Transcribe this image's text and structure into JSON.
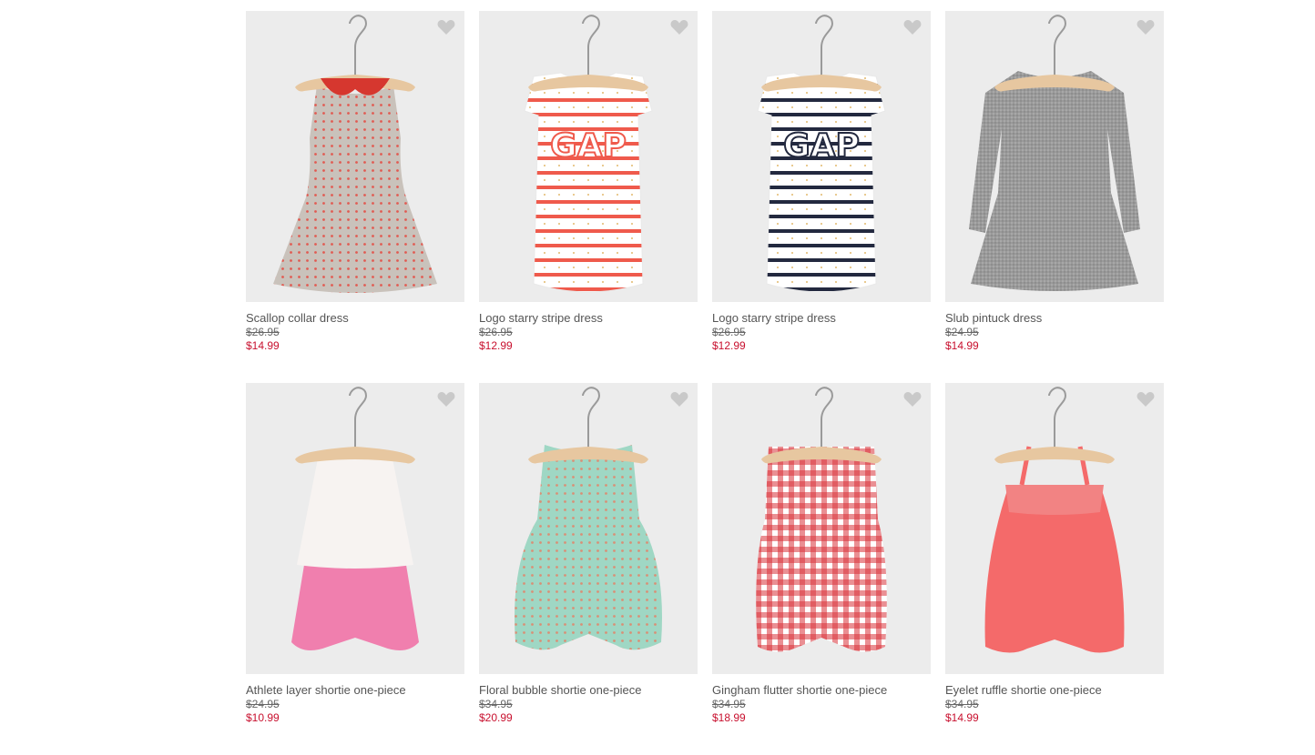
{
  "products": [
    {
      "name": "Scallop collar dress",
      "was": "$26.95",
      "now": "$14.99",
      "garment": "scallop-dress",
      "colors": {
        "main": "#c9c2bb",
        "accent": "#d6372f",
        "dot": "#e15b52"
      }
    },
    {
      "name": "Logo starry stripe dress",
      "was": "$26.95",
      "now": "$12.99",
      "garment": "stripe-dress",
      "colors": {
        "main": "#ffffff",
        "accent": "#ef5a4c",
        "dot": "#d9a441"
      }
    },
    {
      "name": "Logo starry stripe dress",
      "was": "$26.95",
      "now": "$12.99",
      "garment": "stripe-dress",
      "colors": {
        "main": "#ffffff",
        "accent": "#23293f",
        "dot": "#d9a441"
      }
    },
    {
      "name": "Slub pintuck dress",
      "was": "$24.95",
      "now": "$14.99",
      "garment": "sleeve-dress",
      "colors": {
        "main": "#9a9a9a",
        "accent": "#7c7c7c",
        "dot": "#b9b9b9"
      }
    },
    {
      "name": "Athlete layer shortie one-piece",
      "was": "$24.95",
      "now": "$10.99",
      "garment": "layer-romper",
      "colors": {
        "main": "#f07fae",
        "accent": "#f7f3f1",
        "dot": "#e0485a"
      }
    },
    {
      "name": "Floral bubble shortie one-piece",
      "was": "$34.95",
      "now": "$20.99",
      "garment": "romper",
      "colors": {
        "main": "#9fd7c4",
        "accent": "#7cc0a9",
        "dot": "#d99076"
      }
    },
    {
      "name": "Gingham flutter shortie one-piece",
      "was": "$34.95",
      "now": "$18.99",
      "garment": "gingham-romper",
      "colors": {
        "main": "#ffffff",
        "accent": "#d8323a",
        "dot": "#d8323a"
      }
    },
    {
      "name": "Eyelet ruffle shortie one-piece",
      "was": "$34.95",
      "now": "$14.99",
      "garment": "strap-romper",
      "colors": {
        "main": "#f46a6a",
        "accent": "#f28383",
        "dot": "#f46a6a"
      }
    }
  ],
  "theme": {
    "sale_color": "#c8102e",
    "heart_color": "#c9c9c9",
    "card_bg": "#ececec"
  },
  "icons": {
    "favorite": "heart-icon",
    "hanger": "hanger-icon"
  }
}
